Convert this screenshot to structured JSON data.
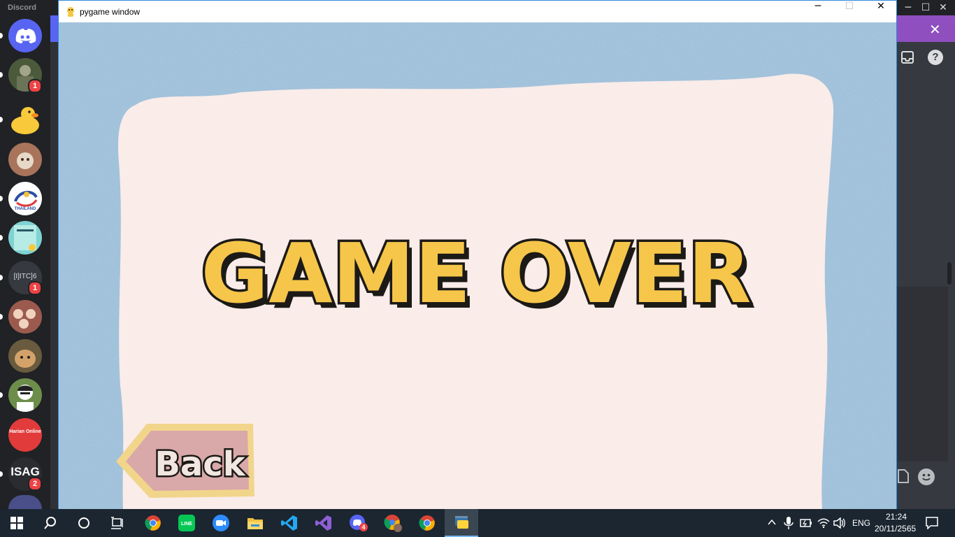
{
  "discord": {
    "brand": "Discord",
    "servers": [
      {
        "name": "direct-messages",
        "badge": ""
      },
      {
        "name": "server-1",
        "badge": "1"
      },
      {
        "name": "server-duck",
        "badge": ""
      },
      {
        "name": "server-3",
        "badge": ""
      },
      {
        "name": "server-thailand",
        "badge": "",
        "label": "THAILAND"
      },
      {
        "name": "server-5",
        "badge": ""
      },
      {
        "name": "server-itc",
        "badge": "1",
        "label": "[I]ITC]6"
      },
      {
        "name": "server-7",
        "badge": ""
      },
      {
        "name": "server-dog",
        "badge": ""
      },
      {
        "name": "server-9",
        "badge": ""
      },
      {
        "name": "server-harian",
        "badge": "",
        "label": "Harian Online"
      },
      {
        "name": "server-isag",
        "badge": "2",
        "label": "ISAG"
      }
    ]
  },
  "pygame": {
    "title": "pygame window",
    "heading": "GAME OVER",
    "back_label": "Back"
  },
  "taskbar": {
    "time": "21:24",
    "date": "20/11/2565",
    "language": "ENG",
    "discord_badge": "4"
  },
  "colors": {
    "border_blue": "#8fb8d6",
    "card_pink": "#faece9",
    "title_yellow": "#f6c64a",
    "outline": "#1c1a17",
    "back_pink": "#d9a8a8",
    "back_border": "#f1d58b"
  }
}
